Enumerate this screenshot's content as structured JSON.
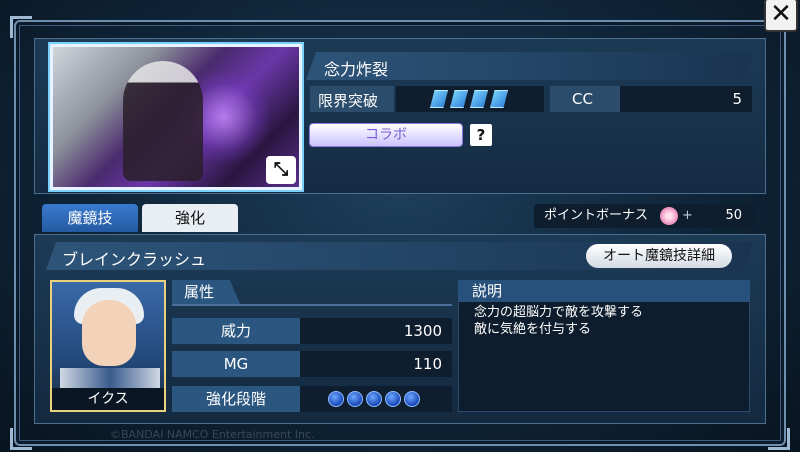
{
  "close_label": "✕",
  "card": {
    "skill_title": "念力炸裂",
    "limit_break_label": "限界突破",
    "limit_break_count": 4,
    "cc_label": "CC",
    "cc_value": "5",
    "collab_label": "コラボ",
    "help_label": "?"
  },
  "tabs": [
    {
      "label": "魔鏡技",
      "active": true
    },
    {
      "label": "強化",
      "active": false
    }
  ],
  "point_bonus": {
    "label": "ポイントボーナス",
    "plus": "+",
    "value": "50"
  },
  "move": {
    "name": "ブレインクラッシュ",
    "auto_details_label": "オート魔鏡技詳細"
  },
  "character": {
    "name": "イクス"
  },
  "attributes": {
    "tab_label": "属性",
    "power_label": "威力",
    "power_value": "1300",
    "mg_label": "MG",
    "mg_value": "110",
    "enhance_label": "強化段階",
    "enhance_level": 5
  },
  "description": {
    "header": "説明",
    "lines": [
      "念力の超脳力で敵を攻撃する",
      "敵に気絶を付与する"
    ]
  },
  "copyright": "©BANDAI NAMCO Entertainment Inc."
}
